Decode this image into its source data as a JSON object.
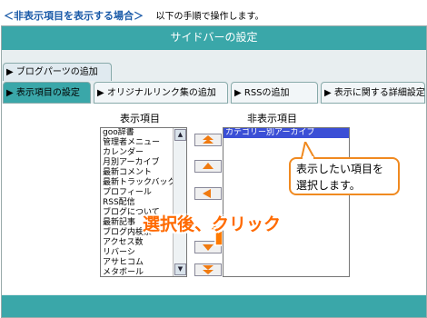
{
  "header": {
    "heading": "＜非表示項目を表示する場合＞",
    "note": "以下の手順で操作します。"
  },
  "window": {
    "title": "サイドバーの設定"
  },
  "tabs_row1": [
    {
      "label": "ブログパーツの追加"
    }
  ],
  "tabs_row2": [
    {
      "label": "表示項目の設定",
      "active": true
    },
    {
      "label": "オリジナルリンク集の追加",
      "active": false
    },
    {
      "label": "RSSの追加",
      "active": false
    },
    {
      "label": "表示に関する詳細設定",
      "active": false
    }
  ],
  "display": {
    "label": "表示項目",
    "items": [
      "goo辞書",
      "管理者メニュー",
      "カレンダー",
      "月別アーカイブ",
      "最新コメント",
      "最新トラックバック",
      "プロフィール",
      "RSS配信",
      "ブログについて",
      "最新記事",
      "ブログ内検索",
      "アクセス数",
      "リバーシ",
      "アサヒコム",
      "メタボール"
    ]
  },
  "hidden": {
    "label": "非表示項目",
    "items": [
      "カテゴリー別アーカイブ"
    ],
    "selected_index": 0
  },
  "callout": {
    "line1": "表示したい項目を",
    "line2": "選択します。"
  },
  "annotation": "選択後、クリック",
  "colors": {
    "titlebar": "#3aa7a9",
    "accent_orange": "#f08a20",
    "selection": "#3b4fd6"
  },
  "icons": {
    "tab_marker": "triangle-right-icon",
    "move_top": "double-up-icon",
    "move_up": "up-icon",
    "move_left": "left-icon",
    "move_down": "down-icon",
    "move_bottom": "double-down-icon"
  }
}
